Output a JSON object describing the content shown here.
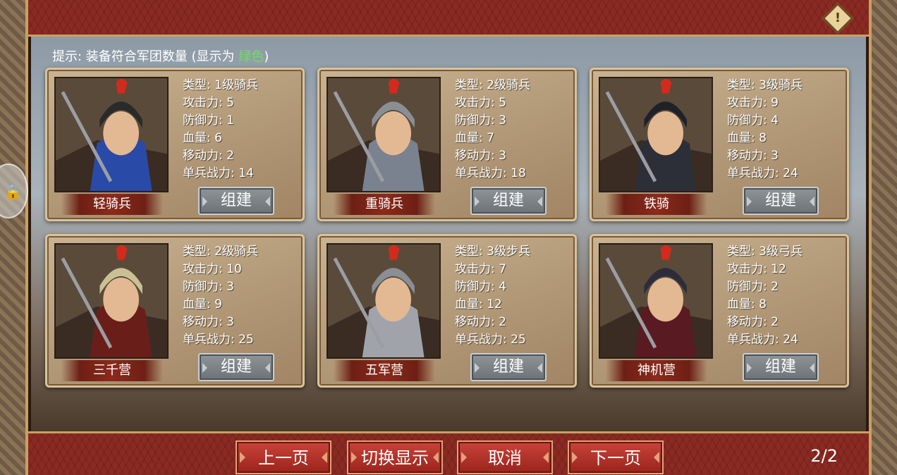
{
  "hint": {
    "prefix": "提示: 装备符合军团数量 (显示为 ",
    "highlight": "绿色",
    "suffix": ")",
    "highlight_color": "#6ce05a"
  },
  "icons": {
    "warning": "warning-diamond-icon"
  },
  "units": [
    {
      "name": "轻骑兵",
      "type": "类型: 1级骑兵",
      "attack": "攻击力: 5",
      "defense": "防御力: 1",
      "hp": "血量: 6",
      "move": "移动力: 2",
      "power": "单兵战力: 14",
      "build_label": "组建",
      "armor_color": "#2a4aa8",
      "helmet_color": "#2a2a2a"
    },
    {
      "name": "重骑兵",
      "type": "类型: 2级骑兵",
      "attack": "攻击力: 5",
      "defense": "防御力: 3",
      "hp": "血量: 7",
      "move": "移动力: 3",
      "power": "单兵战力: 18",
      "build_label": "组建",
      "armor_color": "#7a8290",
      "helmet_color": "#8a8f96"
    },
    {
      "name": "铁骑",
      "type": "类型: 3级骑兵",
      "attack": "攻击力: 9",
      "defense": "防御力: 4",
      "hp": "血量: 8",
      "move": "移动力: 3",
      "power": "单兵战力: 24",
      "build_label": "组建",
      "armor_color": "#2d2f38",
      "helmet_color": "#1f2128"
    },
    {
      "name": "三千营",
      "type": "类型: 2级骑兵",
      "attack": "攻击力: 10",
      "defense": "防御力: 3",
      "hp": "血量: 9",
      "move": "移动力: 3",
      "power": "单兵战力: 25",
      "build_label": "组建",
      "armor_color": "#6a1e1a",
      "helmet_color": "#c9c094"
    },
    {
      "name": "五军营",
      "type": "类型: 3级步兵",
      "attack": "攻击力: 7",
      "defense": "防御力: 4",
      "hp": "血量: 12",
      "move": "移动力: 2",
      "power": "单兵战力: 25",
      "build_label": "组建",
      "armor_color": "#a0a4aa",
      "helmet_color": "#8a8f96"
    },
    {
      "name": "神机营",
      "type": "类型: 3级弓兵",
      "attack": "攻击力: 12",
      "defense": "防御力: 2",
      "hp": "血量: 8",
      "move": "移动力: 2",
      "power": "单兵战力: 24",
      "build_label": "组建",
      "armor_color": "#5a1a22",
      "helmet_color": "#2c2c3c"
    }
  ],
  "bottom": {
    "prev": "上一页",
    "toggle": "切换显示",
    "cancel": "取消",
    "next": "下一页",
    "page": "2/2"
  }
}
